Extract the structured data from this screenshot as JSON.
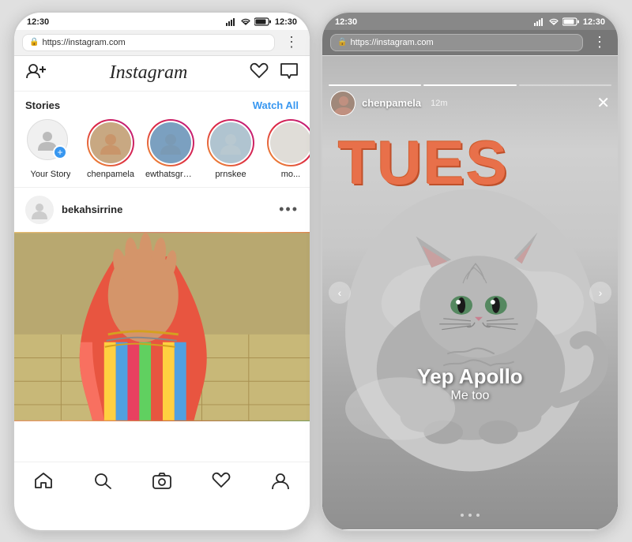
{
  "left_phone": {
    "status_bar": {
      "time": "12:30"
    },
    "browser": {
      "url": "https://instagram.com",
      "dots_label": "⋮"
    },
    "topnav": {
      "add_user_icon": "+👤",
      "logo": "Instagram",
      "icons": [
        "♡",
        "✉"
      ]
    },
    "stories": {
      "section_title": "Stories",
      "watch_all": "Watch All",
      "items": [
        {
          "username": "Your Story",
          "has_plus": true
        },
        {
          "username": "chenpamela",
          "has_plus": false
        },
        {
          "username": "ewthatsgross",
          "has_plus": false
        },
        {
          "username": "prnskee",
          "has_plus": false
        },
        {
          "username": "mo...",
          "has_plus": false
        }
      ]
    },
    "feed": {
      "post_username": "bekahsirrine",
      "post_more": "•••"
    },
    "bottom_nav": {
      "home": "⌂",
      "search": "🔍",
      "camera": "📷",
      "heart": "♡",
      "profile": "👤"
    }
  },
  "right_phone": {
    "status_bar": {
      "time": "12:30"
    },
    "browser": {
      "url": "https://instagram.com",
      "dots_label": "⋮"
    },
    "story": {
      "username": "chenpamela",
      "time_ago": "12m",
      "close_icon": "✕",
      "big_text": "TUES",
      "caption_main": "Yep Apollo",
      "caption_sub": "Me too",
      "progress_segments": [
        1,
        2,
        3
      ],
      "dots": [
        1,
        2,
        3
      ]
    }
  }
}
